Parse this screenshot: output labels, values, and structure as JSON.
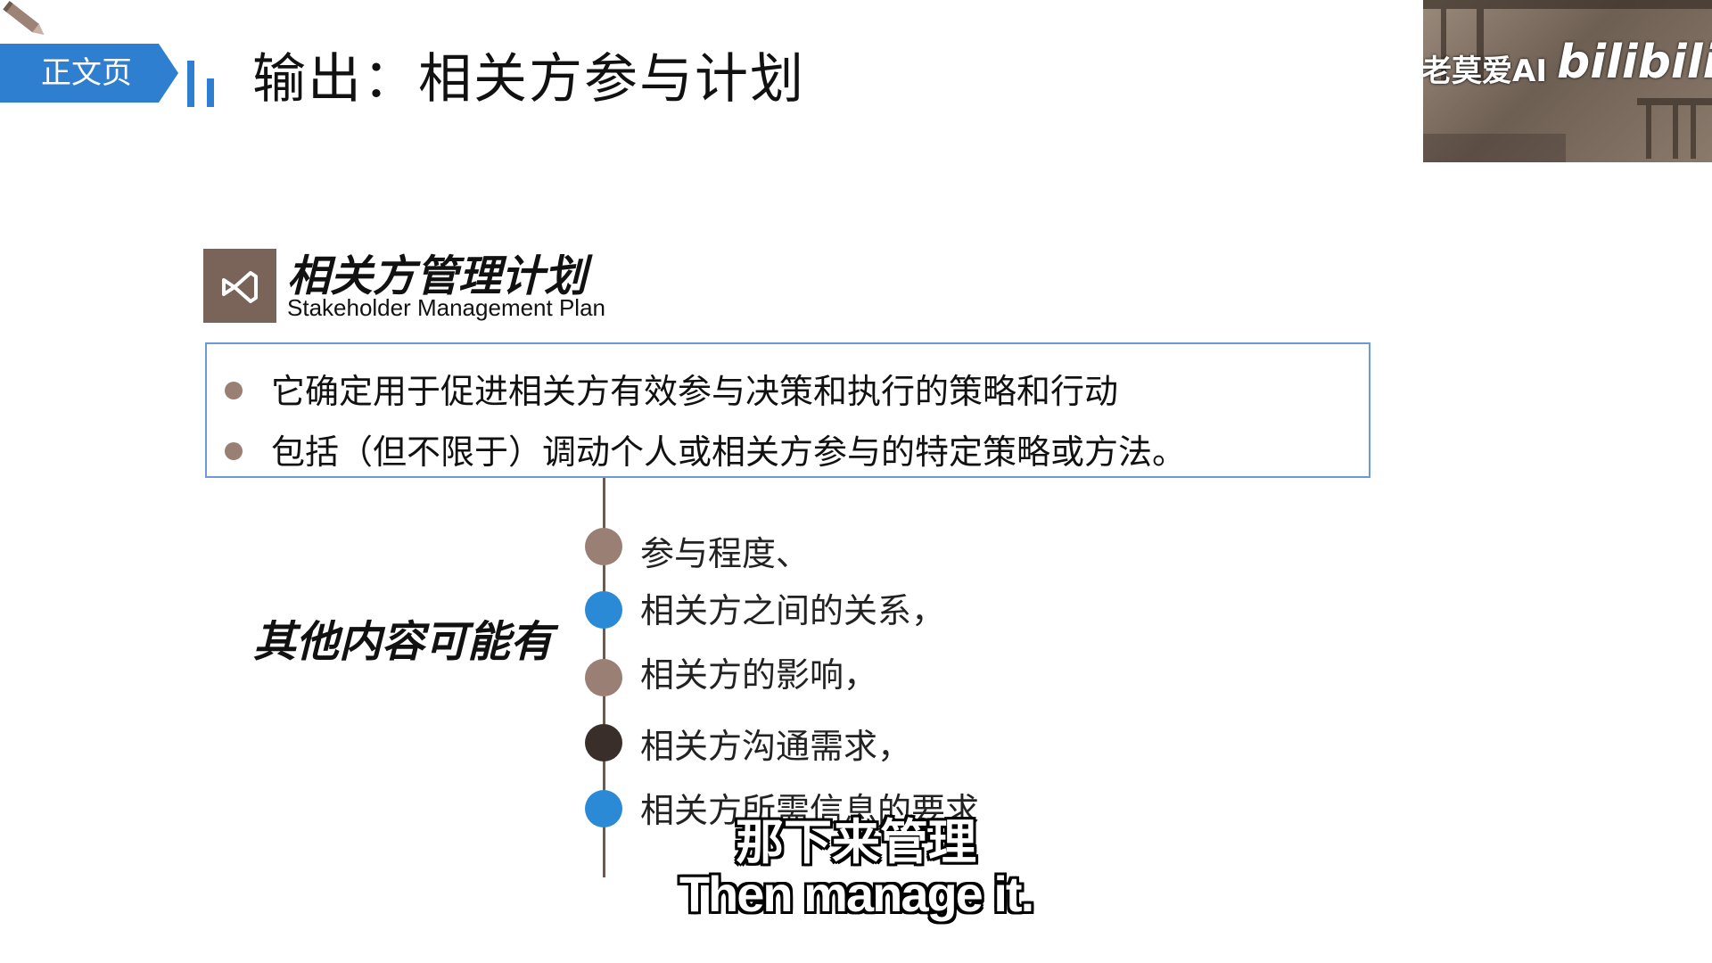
{
  "header": {
    "tag": "正文页",
    "title": "输出：相关方参与计划"
  },
  "video": {
    "caption": "老莫爱AI",
    "logo": "bilibili"
  },
  "plan": {
    "title": "相关方管理计划",
    "subtitle": "Stakeholder Management Plan",
    "icon": "visual-studio-icon"
  },
  "description": {
    "items": [
      "它确定用于促进相关方有效参与决策和执行的策略和行动",
      "包括（但不限于）调动个人或相关方参与的特定策略或方法。"
    ]
  },
  "timeline": {
    "label": "其他内容可能有",
    "items": [
      {
        "text": "参与程度、",
        "color": "#9a7f74"
      },
      {
        "text": "相关方之间的关系，",
        "color": "#2b8ad6"
      },
      {
        "text": "相关方的影响，",
        "color": "#9a7f74"
      },
      {
        "text": "相关方沟通需求，",
        "color": "#3a2e2a"
      },
      {
        "text": "相关方所需信息的要求",
        "color": "#2b8ad6"
      }
    ]
  },
  "subtitles": {
    "chinese": "那下来管理",
    "english": "Then manage it."
  },
  "colors": {
    "accent": "#2f7fd0",
    "brown": "#7a6358"
  }
}
